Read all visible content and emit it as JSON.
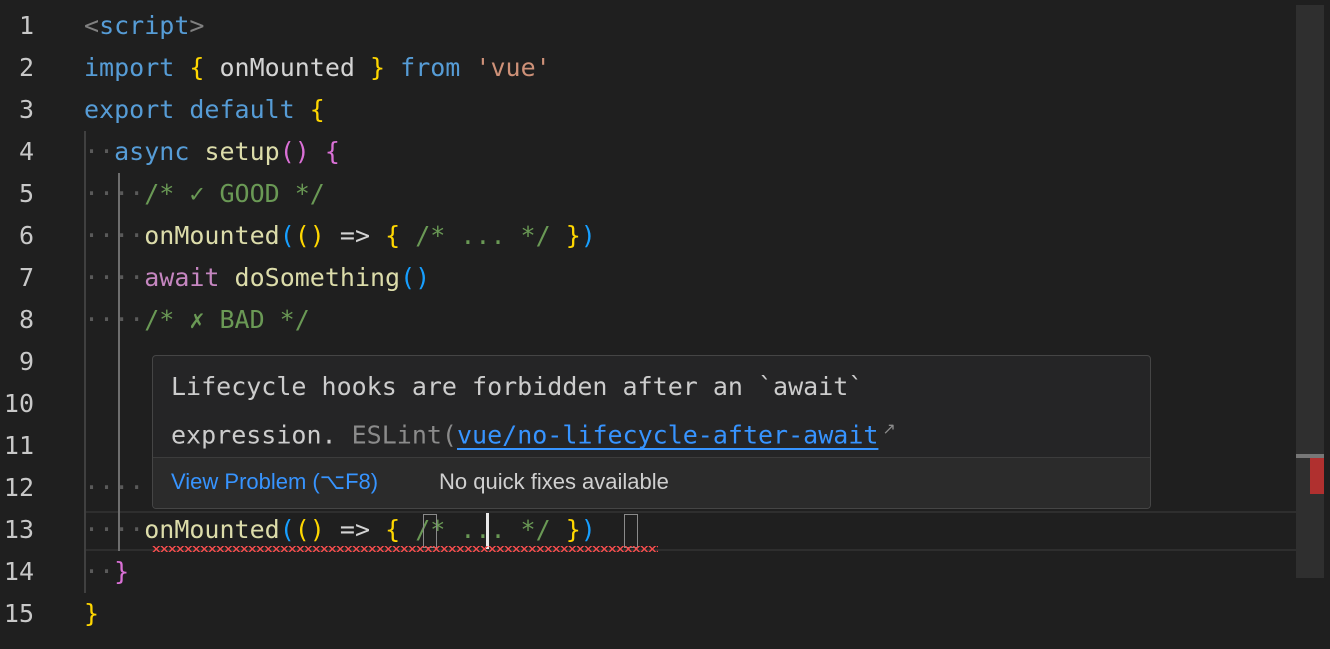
{
  "editor": {
    "language": "vue",
    "cursor": {
      "line": 13
    },
    "lines": [
      {
        "n": "1",
        "indent": "",
        "tokens": [
          [
            "tag",
            "<"
          ],
          [
            "tagname",
            "script"
          ],
          [
            "tag",
            ">"
          ]
        ]
      },
      {
        "n": "2",
        "indent": "",
        "tokens": [
          [
            "kw",
            "import"
          ],
          [
            "id",
            " "
          ],
          [
            "b1",
            "{"
          ],
          [
            "id",
            " onMounted "
          ],
          [
            "b1",
            "}"
          ],
          [
            "id",
            " "
          ],
          [
            "kw",
            "from"
          ],
          [
            "id",
            " "
          ],
          [
            "str",
            "'vue'"
          ]
        ]
      },
      {
        "n": "3",
        "indent": "",
        "tokens": [
          [
            "kw",
            "export"
          ],
          [
            "id",
            " "
          ],
          [
            "kw",
            "default"
          ],
          [
            "id",
            " "
          ],
          [
            "b1",
            "{"
          ]
        ]
      },
      {
        "n": "4",
        "indent": "··",
        "tokens": [
          [
            "kw",
            "async"
          ],
          [
            "id",
            " "
          ],
          [
            "fn",
            "setup"
          ],
          [
            "b2",
            "()"
          ],
          [
            "id",
            " "
          ],
          [
            "b2",
            "{"
          ]
        ]
      },
      {
        "n": "5",
        "indent": "····",
        "tokens": [
          [
            "com",
            "/* ✓ GOOD */"
          ]
        ]
      },
      {
        "n": "6",
        "indent": "····",
        "tokens": [
          [
            "fn",
            "onMounted"
          ],
          [
            "b3",
            "("
          ],
          [
            "b1",
            "()"
          ],
          [
            "id",
            " => "
          ],
          [
            "b1",
            "{"
          ],
          [
            "id",
            " "
          ],
          [
            "com",
            "/* ... */"
          ],
          [
            "id",
            " "
          ],
          [
            "b1",
            "}"
          ],
          [
            "b3",
            ")"
          ]
        ]
      },
      {
        "n": "7",
        "indent": "····",
        "tokens": [
          [
            "kwc",
            "await"
          ],
          [
            "id",
            " "
          ],
          [
            "fn",
            "doSomething"
          ],
          [
            "b3",
            "()"
          ]
        ]
      },
      {
        "n": "8",
        "indent": "····",
        "tokens": [
          [
            "com",
            "/* ✗ BAD */"
          ]
        ]
      },
      {
        "n": "9",
        "indent": "",
        "tokens": []
      },
      {
        "n": "10",
        "indent": "",
        "tokens": []
      },
      {
        "n": "11",
        "indent": "",
        "tokens": []
      },
      {
        "n": "12",
        "indent": "····",
        "tokens": []
      },
      {
        "n": "13",
        "indent": "····",
        "tokens": [
          [
            "fn",
            "onMounted"
          ],
          [
            "b3",
            "("
          ],
          [
            "b1",
            "()"
          ],
          [
            "id",
            " => "
          ],
          [
            "b1",
            "{"
          ],
          [
            "id",
            " "
          ],
          [
            "com",
            "/* ... */"
          ],
          [
            "id",
            " "
          ],
          [
            "b1",
            "}"
          ],
          [
            "b3",
            ")"
          ]
        ]
      },
      {
        "n": "14",
        "indent": "··",
        "tokens": [
          [
            "b2",
            "}"
          ]
        ]
      },
      {
        "n": "15",
        "indent": "",
        "tokens": [
          [
            "b1",
            "}"
          ]
        ]
      }
    ]
  },
  "hover": {
    "message_line1": "Lifecycle hooks are forbidden after an `await`",
    "message_line2": "expression. ",
    "source": "ESLint(",
    "rule": "vue/no-lifecycle-after-await",
    "ext_icon": "↗",
    "view_problem": "View Problem (⌥F8)",
    "no_fixes": "No quick fixes available"
  },
  "colors": {
    "error": "#f14c4c",
    "link": "#3794ff"
  }
}
